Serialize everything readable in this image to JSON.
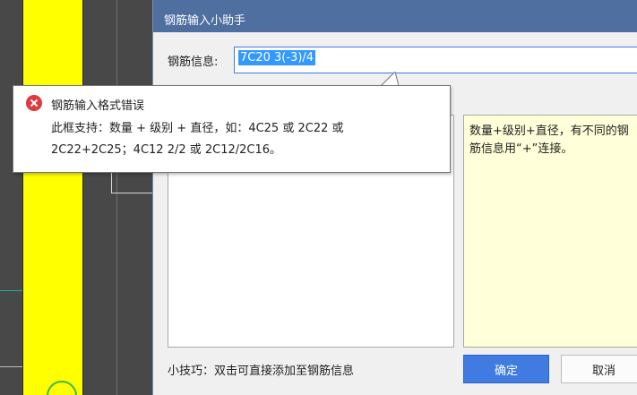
{
  "dialog": {
    "title": "钢筋输入小助手",
    "info_label": "钢筋信息:",
    "info_value": "7C20 3(-3)/4",
    "help_text": "数量+级别+直径，有不同的钢筋信息用“+”连接。",
    "tip": "小技巧：双击可直接添加至钢筋信息",
    "ok_label": "确定",
    "cancel_label": "取消",
    "accent_color": "#3f7be0",
    "titlebar_color": "#4f6fa0"
  },
  "error_tooltip": {
    "icon": "error-circle-icon",
    "title": "钢筋输入格式错误",
    "body_line1": "此框支持：数量 + 级别 + 直径，如：4C25 或 2C22 或",
    "body_line2": "2C22+2C25；4C12 2/2 或 2C12/2C16。",
    "icon_color": "#e0393e"
  },
  "background": {
    "canvas_color": "#484848",
    "strip_color": "#ffff00"
  }
}
